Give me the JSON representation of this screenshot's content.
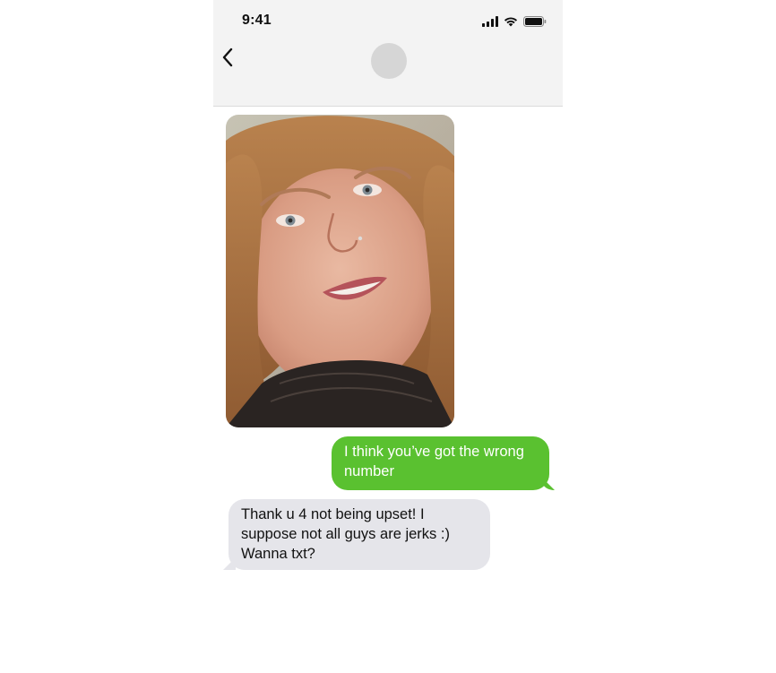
{
  "status_bar": {
    "time": "9:41",
    "icons": [
      "cellular-signal-icon",
      "wifi-icon",
      "battery-icon"
    ]
  },
  "header": {
    "back_icon": "chevron-left-icon",
    "avatar": "contact-avatar"
  },
  "conversation": {
    "messages": [
      {
        "type": "image",
        "direction": "received",
        "description": "photo"
      },
      {
        "type": "text",
        "direction": "sent",
        "text": "I think you’ve got the wrong number"
      },
      {
        "type": "text",
        "direction": "received",
        "text": "Thank u 4 not being upset! I suppose not all guys are jerks :) Wanna txt?"
      }
    ]
  },
  "colors": {
    "sent_bubble": "#5ac130",
    "received_bubble": "#e5e5ea",
    "header_bg": "#f3f3f3"
  }
}
